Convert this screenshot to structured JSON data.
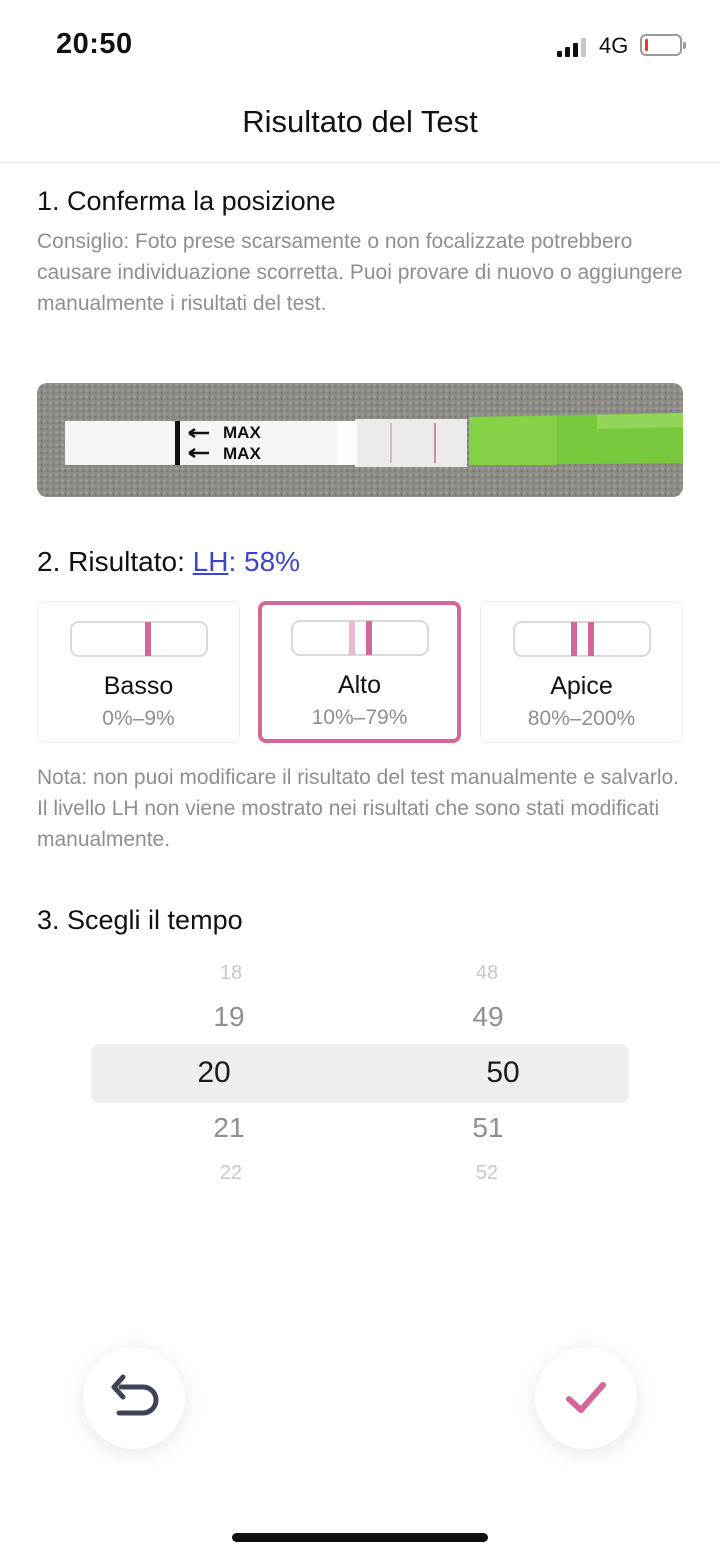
{
  "status_bar": {
    "time": "20:50",
    "network": "4G"
  },
  "nav": {
    "title": "Risultato del Test"
  },
  "section1": {
    "title": "1. Conferma la posizione",
    "tip": "Consiglio: Foto prese scarsamente o non focalizzate potrebbero causare individuazione scorretta. Puoi provare di nuovo o aggiungere manualmente i risultati del test.",
    "strip_label_1": "MAX",
    "strip_label_2": "MAX"
  },
  "section2": {
    "title_prefix": "2. Risultato: ",
    "lh_label": "LH",
    "lh_value": ": 58%",
    "options": [
      {
        "label": "Basso",
        "range": "0%–9%",
        "selected": false
      },
      {
        "label": "Alto",
        "range": "10%–79%",
        "selected": true
      },
      {
        "label": "Apice",
        "range": "80%–200%",
        "selected": false
      }
    ],
    "note": "Nota: non puoi modificare il risultato del test manualmente e salvarlo. Il livello LH non viene mostrato nei risultati che sono stati modificati manualmente."
  },
  "section3": {
    "title": "3. Scegli il tempo",
    "hours": [
      "18",
      "19",
      "20",
      "21",
      "22"
    ],
    "minutes": [
      "48",
      "49",
      "50",
      "51",
      "52"
    ],
    "selected_hour": "20",
    "selected_minute": "50"
  },
  "colors": {
    "accent": "#d4679a",
    "link": "#3e44c6",
    "muted": "#8e8e93"
  },
  "icons": {
    "back": "undo-arrow-icon",
    "confirm": "checkmark-icon"
  }
}
